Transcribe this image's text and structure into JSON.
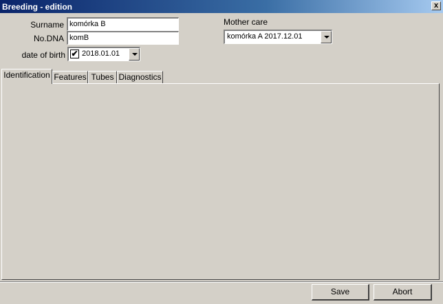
{
  "window": {
    "title": "Breeding - edition",
    "close_label": "x"
  },
  "form": {
    "surname_label": "Surname",
    "surname_value": "komórka B",
    "dna_label": "No.DNA",
    "dna_value": "komB",
    "dob_label": "date of birth",
    "dob_checked": true,
    "dob_check_glyph": "✔",
    "dob_value": "2018.01.01",
    "mother_label": "Mother care",
    "mother_value": "komórka A 2017.12.01"
  },
  "tabs": [
    {
      "label": "Identification",
      "active": true
    },
    {
      "label": "Features",
      "active": false
    },
    {
      "label": "Tubes",
      "active": false
    },
    {
      "label": "Diagnostics",
      "active": false
    }
  ],
  "buttons": {
    "save": "Save",
    "abort": "Abort"
  },
  "icons": {
    "close": "close-icon",
    "dropdown": "chevron-down-icon",
    "check": "checkmark-icon"
  }
}
